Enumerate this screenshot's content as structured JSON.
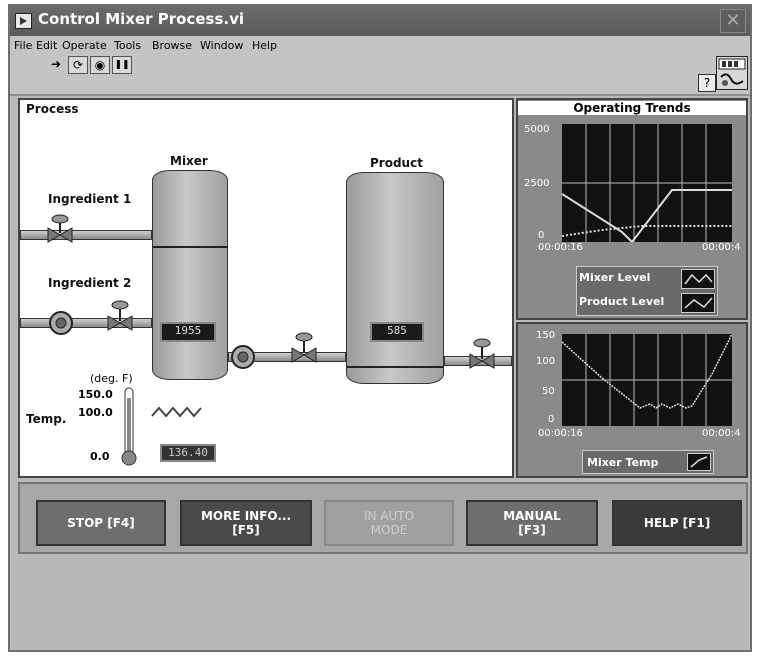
{
  "window": {
    "title": "Control Mixer Process.vi",
    "close_symbol": "✕"
  },
  "menu": [
    {
      "label": "File",
      "key": "F"
    },
    {
      "label": "Edit",
      "key": "E"
    },
    {
      "label": "Operate",
      "key": "O"
    },
    {
      "label": "Tools",
      "key": "T"
    },
    {
      "label": "Browse",
      "key": "B"
    },
    {
      "label": "Window",
      "key": "W"
    },
    {
      "label": "Help",
      "key": "H"
    }
  ],
  "toolbar": {
    "buttons": [
      {
        "name": "run-arrow-icon",
        "glyph": "➜"
      },
      {
        "name": "run-continuously-icon",
        "glyph": "⟳"
      },
      {
        "name": "abort-icon",
        "glyph": "◉"
      },
      {
        "name": "pause-icon",
        "glyph": "❚❚"
      }
    ],
    "help_symbol": "?"
  },
  "process": {
    "panel_label": "Process",
    "mixer_label": "Mixer",
    "product_label": "Product",
    "ingredient1_label": "Ingredient 1",
    "ingredient2_label": "Ingredient 2",
    "mixer_readout": "1955",
    "product_readout": "585",
    "temp_unit": "(deg. F)",
    "temp_label": "Temp.",
    "temp_scale": [
      "150.0",
      "100.0",
      "0.0"
    ],
    "temp_readout": "136.40"
  },
  "trends": {
    "title": "Operating Trends",
    "level_chart": {
      "y_ticks": [
        "5000",
        "2500",
        "0"
      ],
      "x_start": "00:00:16",
      "x_end": "00:00:4",
      "legend": [
        "Mixer Level",
        "Product Level"
      ]
    },
    "temp_chart": {
      "y_ticks": [
        "150",
        "100",
        "50",
        "0"
      ],
      "x_start": "00:00:16",
      "x_end": "00:00:4",
      "legend": [
        "Mixer Temp"
      ]
    }
  },
  "buttons": {
    "stop": "STOP [F4]",
    "more_info": "MORE INFO...\n[F5]",
    "auto_mode": "IN AUTO\nMODE",
    "manual": "MANUAL\n[F3]",
    "help": "HELP [F1]"
  }
}
